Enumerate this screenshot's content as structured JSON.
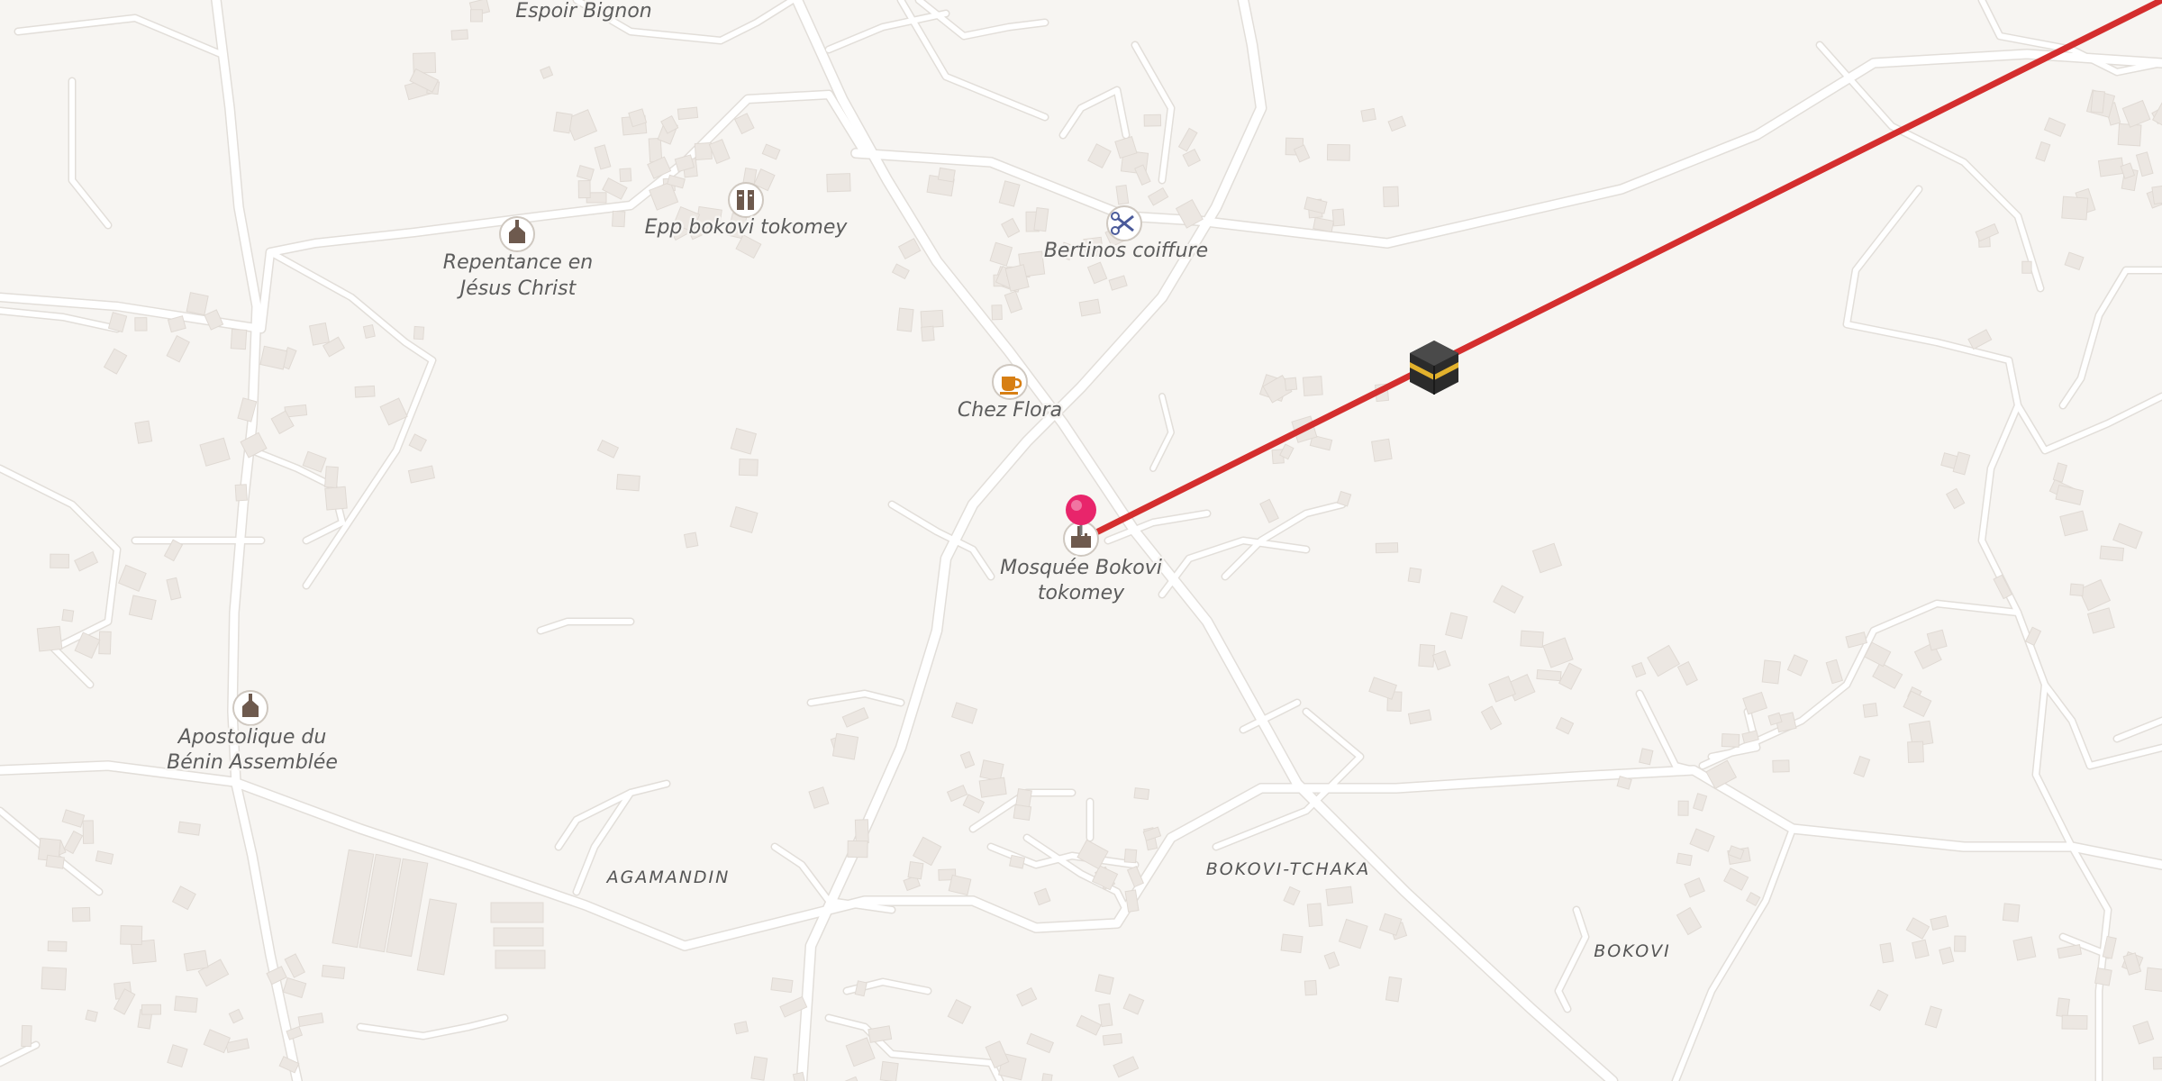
{
  "map": {
    "colors": {
      "background": "#f7f5f2",
      "road": "#ffffff",
      "building": "#ece7e2",
      "route": "#d42e2e",
      "pin": "#e8256b"
    },
    "pois": [
      {
        "id": "espoir-bignon",
        "label": "Espoir Bignon",
        "icon": "none"
      },
      {
        "id": "repentance",
        "label": "Repentance en",
        "label2": "Jésus Christ",
        "icon": "church-icon"
      },
      {
        "id": "epp-bokovi",
        "label": "Epp bokovi tokomey",
        "icon": "school-icon"
      },
      {
        "id": "bertinos",
        "label": "Bertinos coiffure",
        "icon": "scissors-icon"
      },
      {
        "id": "chez-flora",
        "label": "Chez Flora",
        "icon": "cafe-icon"
      },
      {
        "id": "mosquee",
        "label": "Mosquée Bokovi",
        "label2": "tokomey",
        "icon": "mosque-icon"
      },
      {
        "id": "apostolique",
        "label": "Apostolique du",
        "label2": "Bénin Assemblée",
        "icon": "church-icon"
      }
    ],
    "places": [
      {
        "id": "agamandin",
        "label": "AGAMANDIN"
      },
      {
        "id": "bokovi-tchaka",
        "label": "BOKOVI-TCHAKA"
      },
      {
        "id": "bokovi",
        "label": "BOKOVI"
      }
    ],
    "route": {
      "description": "qibla-direction-line",
      "marker": "kaaba-icon"
    },
    "pin": {
      "icon": "location-pin-icon"
    }
  }
}
